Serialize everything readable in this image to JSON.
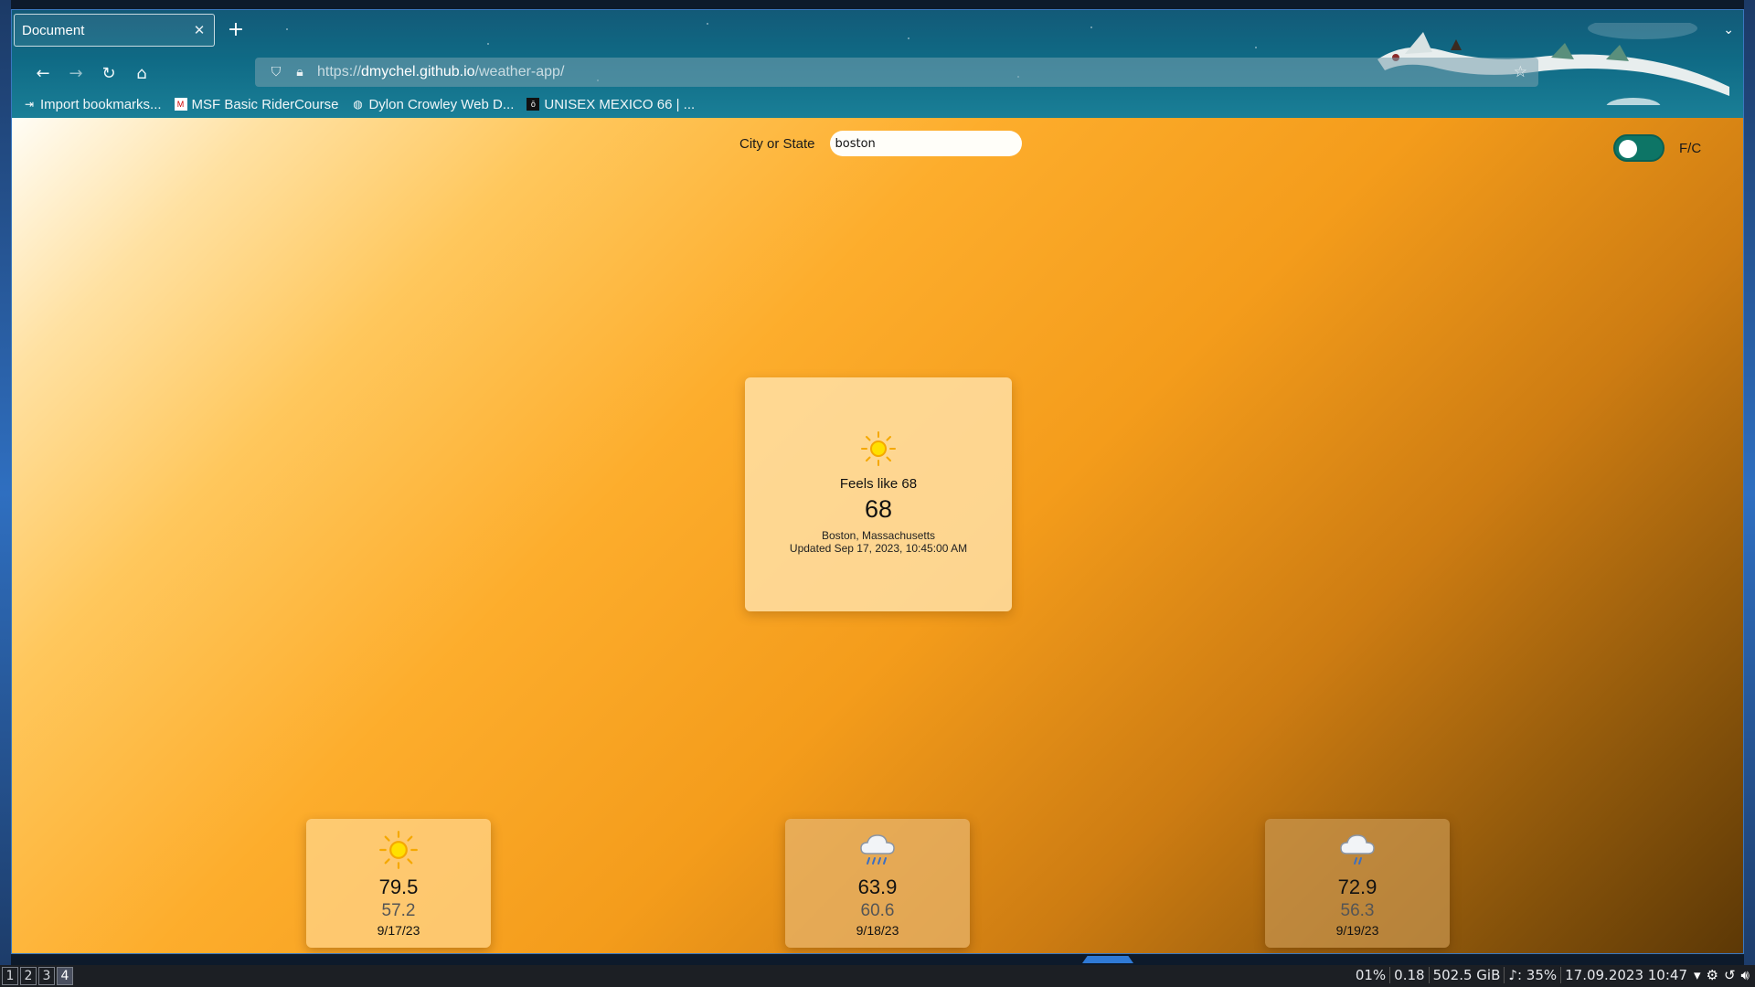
{
  "browser": {
    "tab_title": "Document",
    "url_prefix": "https://",
    "url_host": "dmychel.github.io",
    "url_path": "/weather-app/",
    "bookmarks": [
      {
        "label": "Import bookmarks...",
        "icon": "import-icon"
      },
      {
        "label": "MSF Basic RiderCourse",
        "icon": "msf-favicon"
      },
      {
        "label": "Dylon Crowley Web D...",
        "icon": "globe-icon"
      },
      {
        "label": "UNISEX MEXICO 66 | ...",
        "icon": "onitsuka-favicon"
      }
    ]
  },
  "search": {
    "label": "City or State",
    "value": "boston"
  },
  "unit_toggle": {
    "label": "F/C",
    "color": "#0d7566"
  },
  "current": {
    "icon": "sun-icon",
    "feels_like": "Feels like 68",
    "temperature": "68",
    "location": "Boston, Massachusetts",
    "updated": "Updated Sep 17, 2023, 10:45:00 AM"
  },
  "forecast": [
    {
      "icon": "sun-icon",
      "high": "79.5",
      "low": "57.2",
      "date": "9/17/23"
    },
    {
      "icon": "rain-icon",
      "high": "63.9",
      "low": "60.6",
      "date": "9/18/23"
    },
    {
      "icon": "light-rain-icon",
      "high": "72.9",
      "low": "56.3",
      "date": "9/19/23"
    }
  ],
  "taskbar": {
    "workspaces": [
      "1",
      "2",
      "3",
      "4"
    ],
    "active_workspace": "4",
    "cpu": "01%",
    "load": "0.18",
    "disk": "502.5 GiB",
    "volume": "♪: 35%",
    "datetime": "17.09.2023 10:47"
  }
}
